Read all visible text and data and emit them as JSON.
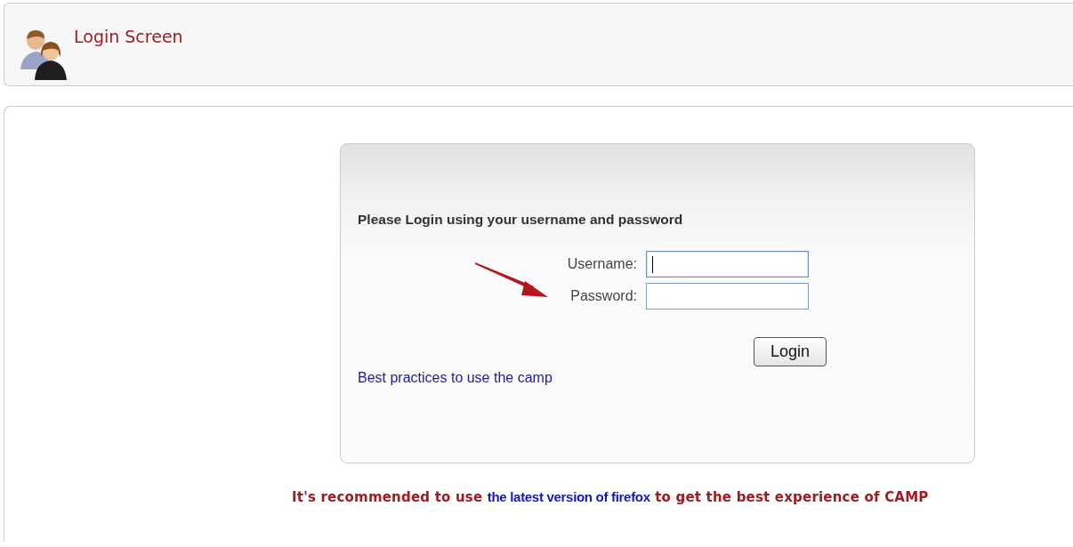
{
  "header": {
    "title": "Login Screen"
  },
  "login_box": {
    "heading": "Please Login using your username and password",
    "fields": [
      {
        "label": "Username:",
        "focused": true
      },
      {
        "label": "Password:",
        "focused": false
      }
    ],
    "button": "Login",
    "link": "Best practices to use the camp"
  },
  "notice": {
    "before": "It's recommended to use ",
    "link": "the latest version of firefox",
    "after": " to get the best experience of CAMP"
  }
}
